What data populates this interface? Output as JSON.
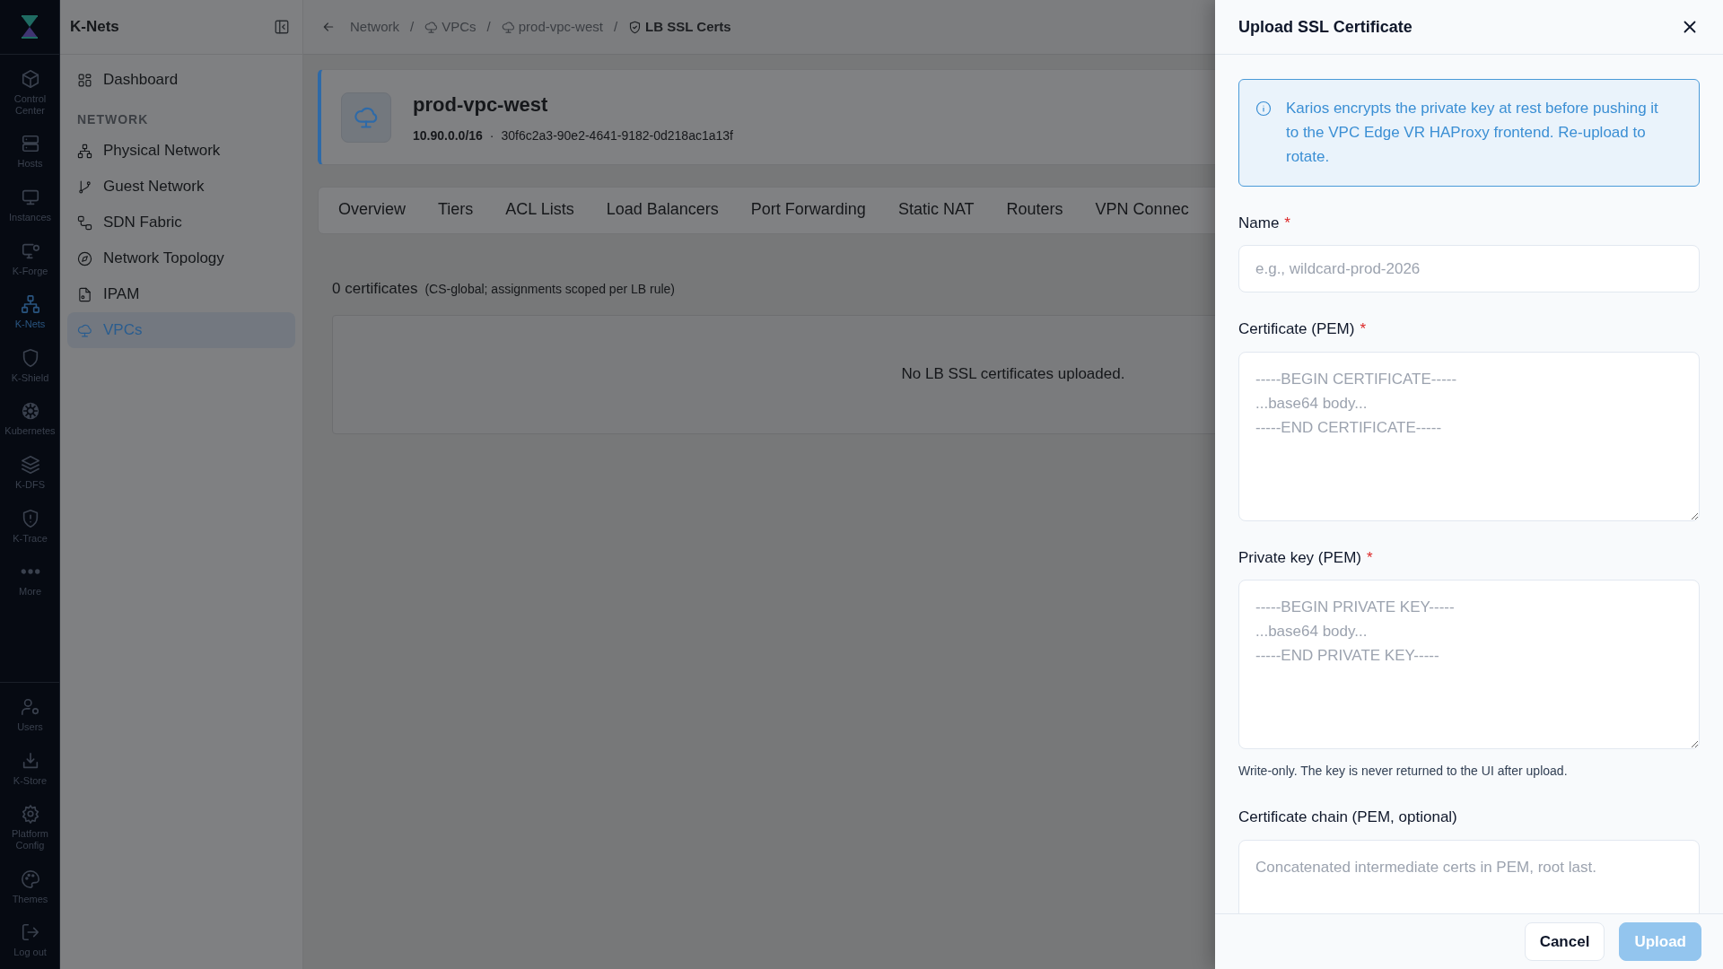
{
  "rail": {
    "items": [
      {
        "label": "Control Center",
        "selected": false
      },
      {
        "label": "Hosts",
        "selected": false
      },
      {
        "label": "Instances",
        "selected": false
      },
      {
        "label": "K-Forge",
        "selected": false
      },
      {
        "label": "K-Nets",
        "selected": true
      },
      {
        "label": "K-Shield",
        "selected": false
      },
      {
        "label": "Kubernetes",
        "selected": false
      },
      {
        "label": "K-DFS",
        "selected": false
      },
      {
        "label": "K-Trace",
        "selected": false
      },
      {
        "label": "More",
        "selected": false
      }
    ],
    "bottom_items": [
      {
        "label": "Users",
        "selected": false
      },
      {
        "label": "K-Store",
        "selected": false
      },
      {
        "label": "Platform Config",
        "selected": false
      },
      {
        "label": "Themes",
        "selected": false
      },
      {
        "label": "Log out",
        "selected": false
      }
    ]
  },
  "sidebar": {
    "title": "K-Nets",
    "items": [
      {
        "label": "Dashboard",
        "selected": false
      }
    ],
    "section": "NETWORK",
    "section_items": [
      {
        "label": "Physical Network",
        "selected": false
      },
      {
        "label": "Guest Network",
        "selected": false
      },
      {
        "label": "SDN Fabric",
        "selected": false
      },
      {
        "label": "Network Topology",
        "selected": false
      },
      {
        "label": "IPAM",
        "selected": false
      },
      {
        "label": "VPCs",
        "selected": true
      }
    ]
  },
  "breadcrumb": [
    {
      "label": "Network",
      "current": false
    },
    {
      "label": "VPCs",
      "current": false
    },
    {
      "label": "prod-vpc-west",
      "current": false
    },
    {
      "label": "LB SSL Certs",
      "current": true
    }
  ],
  "breadcrumb_separator": "/",
  "vpc": {
    "name": "prod-vpc-west",
    "cidr": "10.90.0.0/16",
    "separator": "·",
    "id": "30f6c2a3-90e2-4641-9182-0d218ac1a13f"
  },
  "tabs": [
    {
      "label": "Overview",
      "selected": false
    },
    {
      "label": "Tiers",
      "selected": false
    },
    {
      "label": "ACL Lists",
      "selected": false
    },
    {
      "label": "Load Balancers",
      "selected": false
    },
    {
      "label": "Port Forwarding",
      "selected": false
    },
    {
      "label": "Static NAT",
      "selected": false
    },
    {
      "label": "Routers",
      "selected": false
    },
    {
      "label": "VPN Connec",
      "selected": false
    }
  ],
  "summary": {
    "count": "0 certificates",
    "note": "(CS-global; assignments scoped per LB rule)"
  },
  "empty_message": "No LB SSL certificates uploaded.",
  "drawer": {
    "title": "Upload SSL Certificate",
    "info": "Karios encrypts the private key at rest before pushing it to the VPC Edge VR HAProxy frontend. Re-upload to rotate.",
    "fields": [
      {
        "kind": "input",
        "label": "Name",
        "required_mark": "*",
        "placeholder": "e.g., wildcard-prod-2026"
      },
      {
        "kind": "textarea",
        "label": "Certificate (PEM)",
        "required_mark": "*",
        "placeholder": "-----BEGIN CERTIFICATE-----\n...base64 body...\n-----END CERTIFICATE-----"
      },
      {
        "kind": "textarea",
        "label": "Private key (PEM)",
        "required_mark": "*",
        "placeholder": "-----BEGIN PRIVATE KEY-----\n...base64 body...\n-----END PRIVATE KEY-----",
        "help": "Write-only. The key is never returned to the UI after upload."
      },
      {
        "kind": "textarea",
        "label": "Certificate chain (PEM, optional)",
        "placeholder": "Concatenated intermediate certs in PEM, root last."
      }
    ],
    "buttons": [
      {
        "label": "Cancel",
        "kind": "secondary",
        "disabled": false
      },
      {
        "label": "Upload",
        "kind": "primary",
        "disabled": true
      }
    ]
  }
}
